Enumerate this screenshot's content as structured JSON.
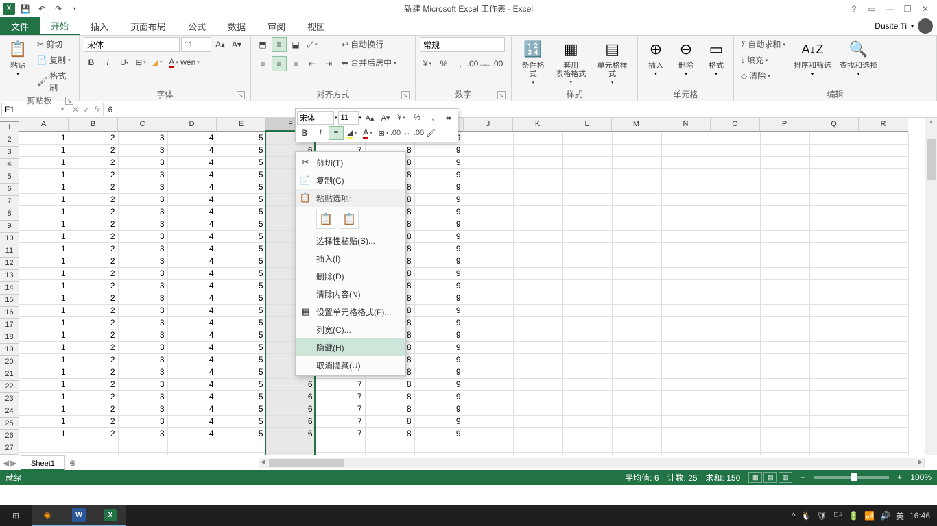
{
  "title": "新建 Microsoft Excel 工作表 - Excel",
  "user": "Dusite Ti",
  "tabs": {
    "file": "文件",
    "home": "开始",
    "insert": "插入",
    "layout": "页面布局",
    "formulas": "公式",
    "data": "数据",
    "review": "审阅",
    "view": "视图"
  },
  "ribbon": {
    "clipboard": {
      "label": "剪贴板",
      "paste": "粘贴",
      "cut": "剪切",
      "copy": "复制",
      "format_painter": "格式刷"
    },
    "font": {
      "label": "字体",
      "name": "宋体",
      "size": "11"
    },
    "alignment": {
      "label": "对齐方式",
      "wrap": "自动换行",
      "merge": "合并后居中"
    },
    "number": {
      "label": "数字",
      "format": "常规"
    },
    "styles": {
      "label": "样式",
      "cond": "条件格式",
      "table": "套用\n表格格式",
      "cell": "单元格样式"
    },
    "cells": {
      "label": "单元格",
      "insert": "插入",
      "delete": "删除",
      "format": "格式"
    },
    "editing": {
      "label": "编辑",
      "autosum": "自动求和",
      "fill": "填充",
      "clear": "清除",
      "sort": "排序和筛选",
      "find": "查找和选择"
    }
  },
  "formula_bar": {
    "name_box": "F1",
    "value": "6"
  },
  "grid": {
    "columns": [
      "A",
      "B",
      "C",
      "D",
      "E",
      "F",
      "G",
      "H",
      "I",
      "J",
      "K",
      "L",
      "M",
      "N",
      "O",
      "P",
      "Q",
      "R"
    ],
    "row_count": 27,
    "data_rows": 25,
    "values": [
      1,
      2,
      3,
      4,
      5,
      6,
      7,
      8,
      9
    ],
    "selected_col_index": 5
  },
  "mini_toolbar": {
    "font": "宋体",
    "size": "11"
  },
  "context_menu": {
    "cut": "剪切(T)",
    "copy": "复制(C)",
    "paste_header": "粘贴选项:",
    "paste_special": "选择性粘贴(S)...",
    "insert": "插入(I)",
    "delete": "删除(D)",
    "clear": "清除内容(N)",
    "format_cells": "设置单元格格式(F)...",
    "col_width": "列宽(C)...",
    "hide": "隐藏(H)",
    "unhide": "取消隐藏(U)"
  },
  "sheet_tab": "Sheet1",
  "status": {
    "ready": "就绪",
    "avg_label": "平均值:",
    "avg": "6",
    "count_label": "计数:",
    "count": "25",
    "sum_label": "求和:",
    "sum": "150",
    "zoom": "100%"
  },
  "clock": "16:46",
  "ime": "英"
}
